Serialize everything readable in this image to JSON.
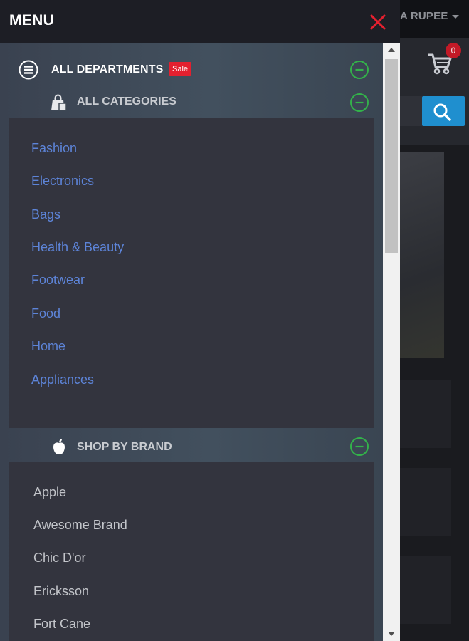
{
  "background": {
    "currency_label": "A RUPEE",
    "cart_count": "0"
  },
  "menu": {
    "title": "MENU",
    "departments": {
      "label": "ALL DEPARTMENTS",
      "badge": "Sale"
    },
    "categories": {
      "label": "ALL CATEGORIES",
      "items": [
        "Fashion",
        "Electronics",
        "Bags",
        "Health & Beauty",
        "Footwear",
        "Food",
        "Home",
        "Appliances"
      ]
    },
    "brands": {
      "label": "SHOP BY BRAND",
      "items": [
        "Apple",
        "Awesome Brand",
        "Chic D'or",
        "Ericksson",
        "Fort Cane"
      ]
    }
  },
  "colors": {
    "accent_link": "#5d84d8",
    "sale_badge": "#e3202f",
    "toggle_green": "#33b24a",
    "close_red": "#e3202f",
    "search_blue": "#1f8fcf"
  },
  "icons": {
    "close": "close-icon",
    "departments": "list-circle-icon",
    "categories": "shopping-bag-icon",
    "brand": "apple-icon",
    "toggle": "minus-circle-icon",
    "cart": "cart-icon",
    "search": "search-icon"
  }
}
